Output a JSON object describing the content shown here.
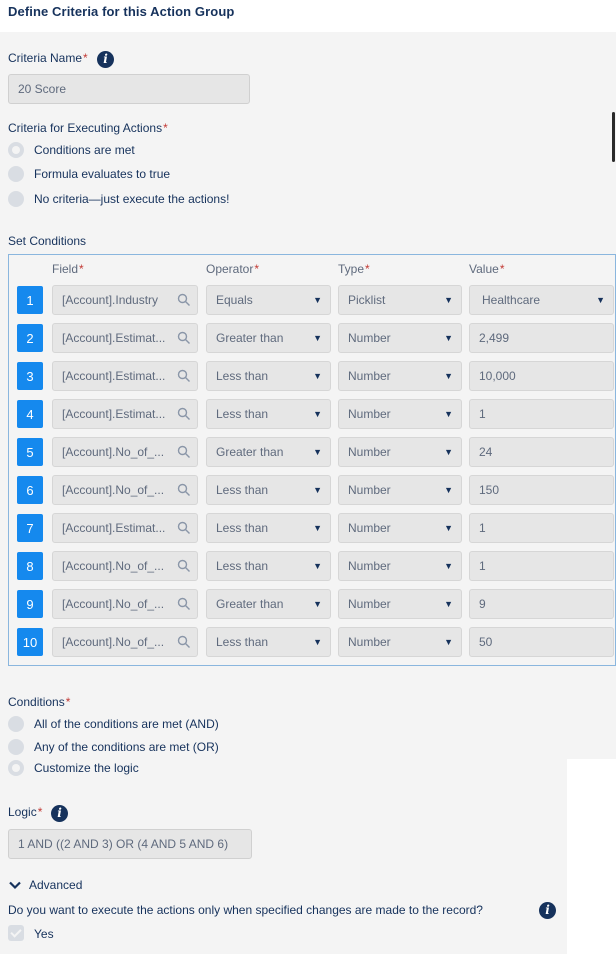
{
  "header": {
    "title": "Define Criteria for this Action Group"
  },
  "criteria_name": {
    "label": "Criteria Name",
    "required_mark": "*",
    "value": "20 Score"
  },
  "executing": {
    "label": "Criteria for Executing Actions",
    "required_mark": "*",
    "options": [
      "Conditions are met",
      "Formula evaluates to true",
      "No criteria—just execute the actions!"
    ],
    "selected_index": 0
  },
  "set_conditions": {
    "label": "Set Conditions",
    "columns": {
      "field": "Field",
      "operator": "Operator",
      "type": "Type",
      "value": "Value",
      "required_mark": "*"
    },
    "rows": [
      {
        "num": "1",
        "field": "[Account].Industry",
        "operator": "Equals",
        "type": "Picklist",
        "value": "Healthcare",
        "value_is_select": true
      },
      {
        "num": "2",
        "field": "[Account].Estimat...",
        "operator": "Greater than",
        "type": "Number",
        "value": "2,499"
      },
      {
        "num": "3",
        "field": "[Account].Estimat...",
        "operator": "Less than",
        "type": "Number",
        "value": "10,000"
      },
      {
        "num": "4",
        "field": "[Account].Estimat...",
        "operator": "Less than",
        "type": "Number",
        "value": "1"
      },
      {
        "num": "5",
        "field": "[Account].No_of_...",
        "operator": "Greater than",
        "type": "Number",
        "value": "24"
      },
      {
        "num": "6",
        "field": "[Account].No_of_...",
        "operator": "Less than",
        "type": "Number",
        "value": "150"
      },
      {
        "num": "7",
        "field": "[Account].Estimat...",
        "operator": "Less than",
        "type": "Number",
        "value": "1"
      },
      {
        "num": "8",
        "field": "[Account].No_of_...",
        "operator": "Less than",
        "type": "Number",
        "value": "1"
      },
      {
        "num": "9",
        "field": "[Account].No_of_...",
        "operator": "Greater than",
        "type": "Number",
        "value": "9"
      },
      {
        "num": "10",
        "field": "[Account].No_of_...",
        "operator": "Less than",
        "type": "Number",
        "value": "50"
      }
    ]
  },
  "conditions": {
    "label": "Conditions",
    "required_mark": "*",
    "options": [
      "All of the conditions are met (AND)",
      "Any of the conditions are met (OR)",
      "Customize the logic"
    ],
    "selected_index": 2
  },
  "logic": {
    "label": "Logic",
    "required_mark": "*",
    "value": "1 AND ((2 AND 3) OR (4 AND 5 AND 6)"
  },
  "advanced": {
    "label": "Advanced",
    "question": "Do you want to execute the actions only when specified changes are made to the record?",
    "checkbox_label": "Yes",
    "checked": true
  },
  "colors": {
    "accent": "#1589ee",
    "text": "#16325c",
    "required": "#c23934",
    "field_bg": "#e6e6e6",
    "panel_bg": "#f4f4f4"
  }
}
